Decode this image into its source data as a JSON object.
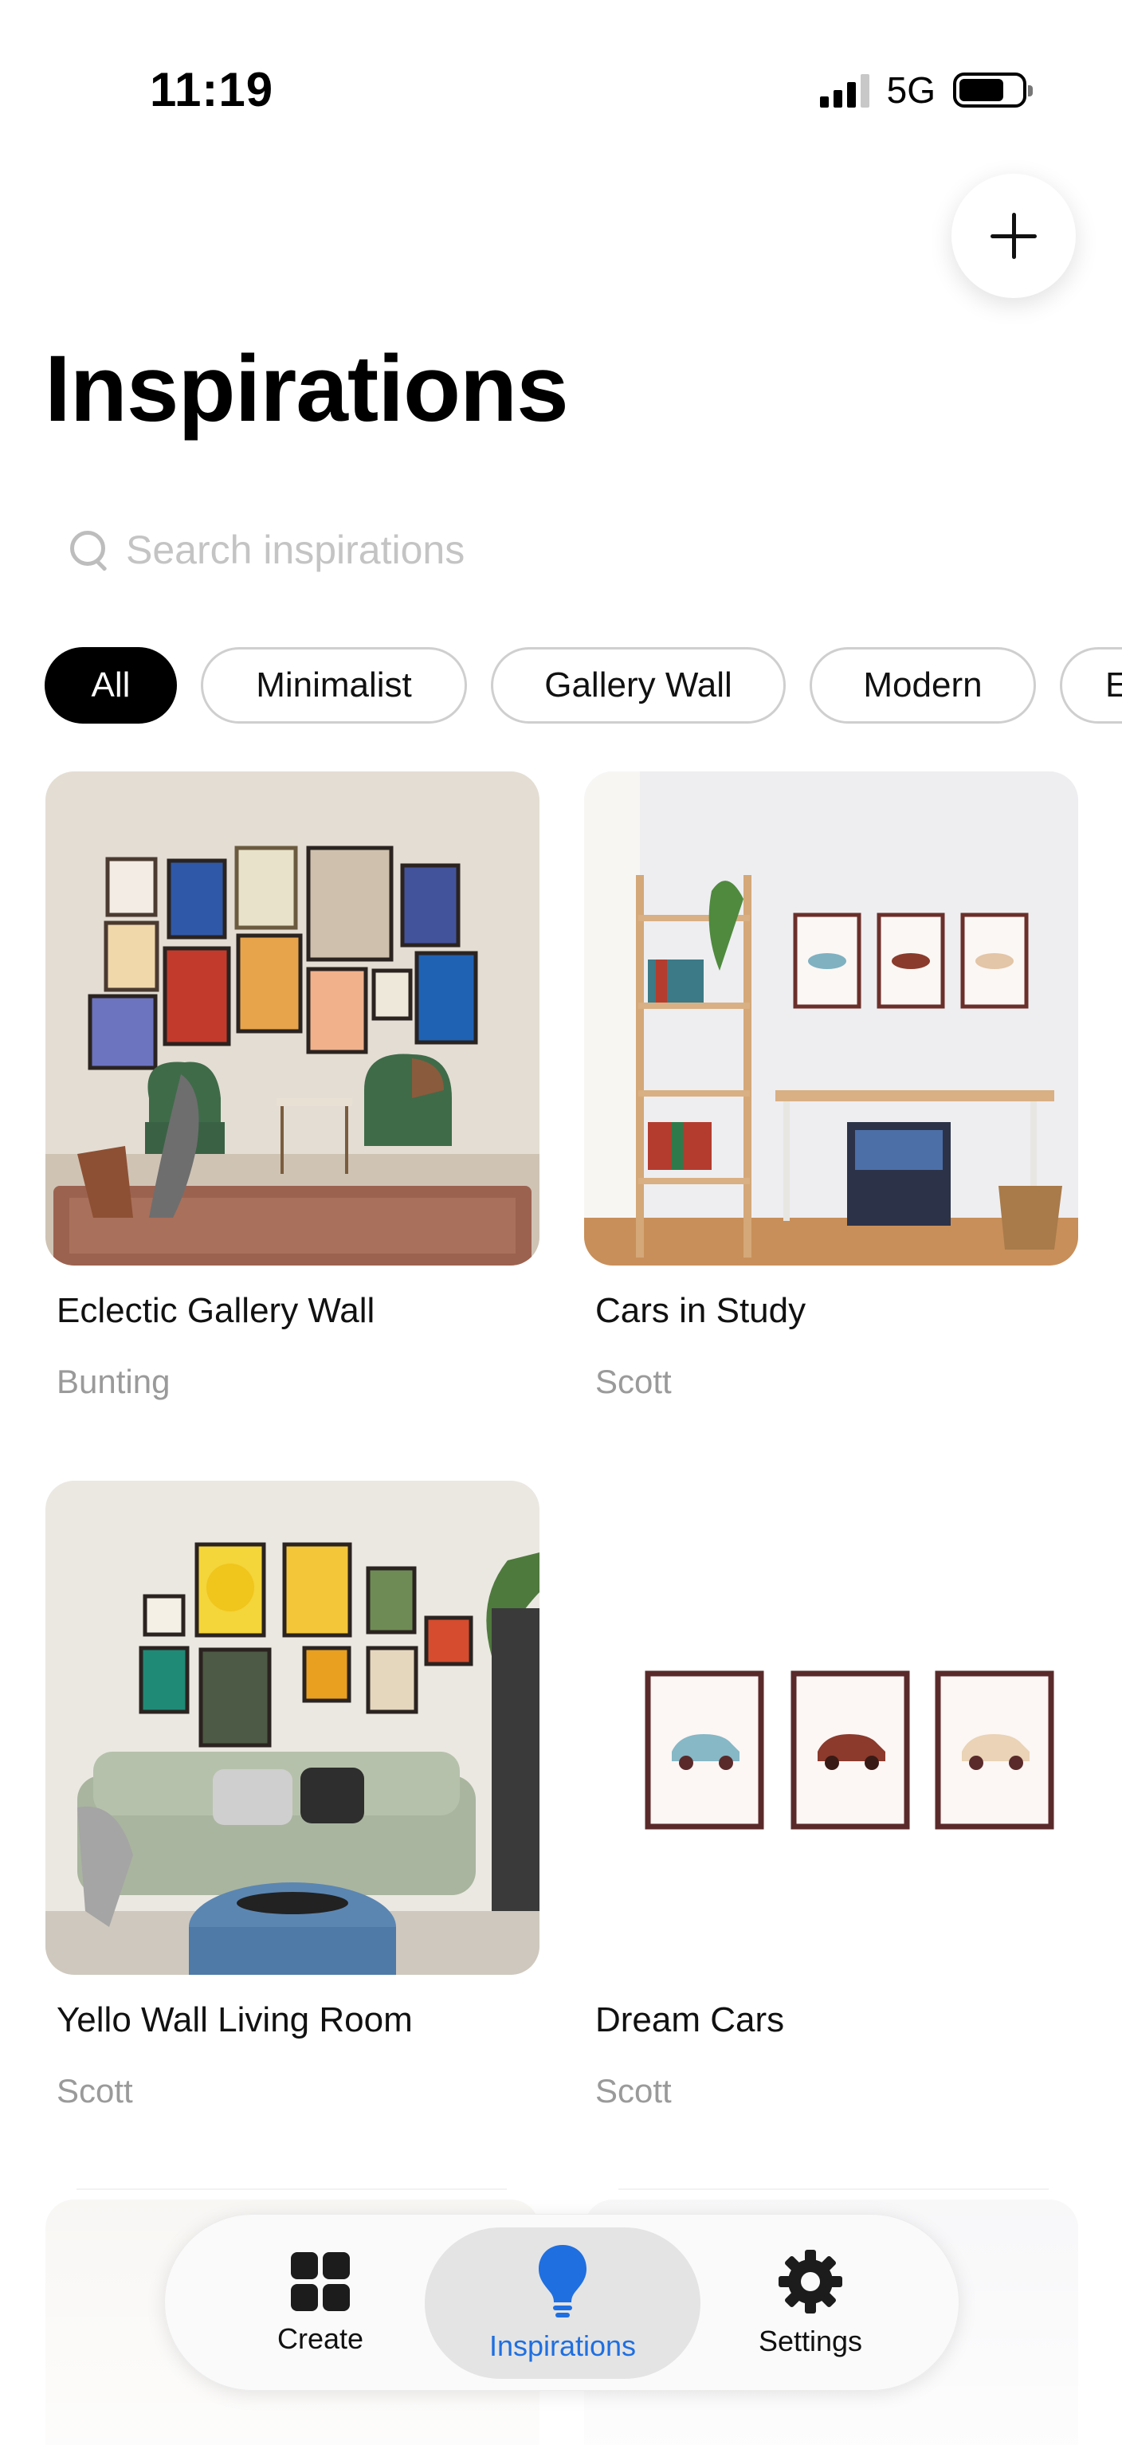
{
  "status_bar": {
    "time": "11:19",
    "network": "5G",
    "battery_level": 0.72
  },
  "header": {
    "title": "Inspirations",
    "add_icon": "plus-icon"
  },
  "search": {
    "placeholder": "Search inspirations",
    "value": ""
  },
  "filters": [
    {
      "label": "All",
      "active": true
    },
    {
      "label": "Minimalist",
      "active": false
    },
    {
      "label": "Gallery Wall",
      "active": false
    },
    {
      "label": "Modern",
      "active": false
    },
    {
      "label": "E",
      "active": false
    }
  ],
  "cards": [
    {
      "title": "Eclectic Gallery Wall",
      "author": "Bunting"
    },
    {
      "title": "Cars in Study",
      "author": "Scott"
    },
    {
      "title": "Yello Wall Living Room",
      "author": "Scott"
    },
    {
      "title": "Dream Cars",
      "author": "Scott"
    }
  ],
  "nav": [
    {
      "label": "Create",
      "icon": "grid-icon",
      "active": false
    },
    {
      "label": "Inspirations",
      "icon": "lightbulb-icon",
      "active": true
    },
    {
      "label": "Settings",
      "icon": "gear-icon",
      "active": false
    }
  ],
  "colors": {
    "accent": "#1f6fe0",
    "chip_active": "#000000",
    "secondary_text": "#9a9a9a"
  }
}
